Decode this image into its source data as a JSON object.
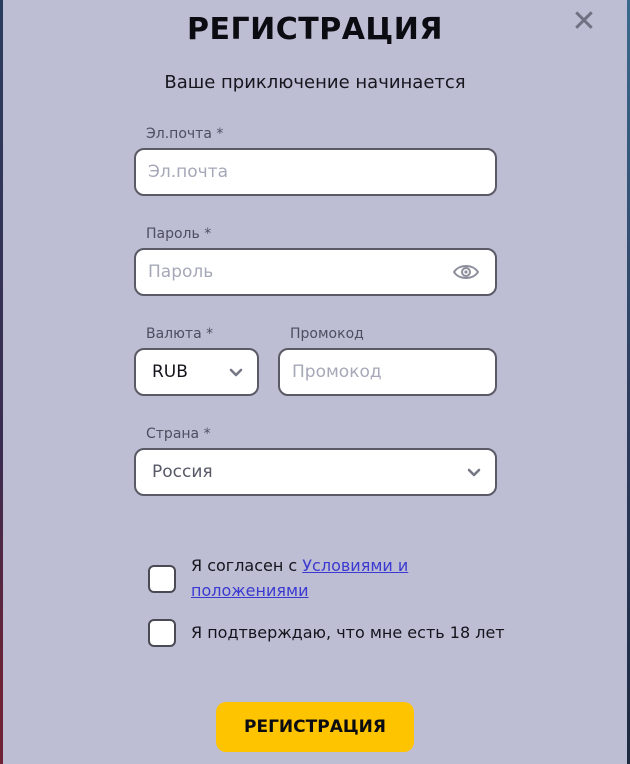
{
  "modal": {
    "close_glyph": "✕",
    "title": "РЕГИСТРАЦИЯ",
    "subtitle": "Ваше приключение начинается"
  },
  "form": {
    "email": {
      "label": "Эл.почта *",
      "placeholder": "Эл.почта",
      "value": ""
    },
    "password": {
      "label": "Пароль *",
      "placeholder": "Пароль",
      "value": "",
      "icon": "eye-icon"
    },
    "currency": {
      "label": "Валюта *",
      "selected": "RUB"
    },
    "promo": {
      "label": "Промокод",
      "placeholder": "Промокод",
      "value": ""
    },
    "country": {
      "label": "Страна *",
      "selected": "Россия"
    }
  },
  "agreements": {
    "terms_prefix": "Я согласен с ",
    "terms_link": "Условиями и положениями",
    "terms_checked": false,
    "age_text": "Я подтверждаю, что мне есть 18 лет",
    "age_checked": false
  },
  "submit_label": "РЕГИСТРАЦИЯ",
  "colors": {
    "modal_bg": "#bdbdd4",
    "accent": "#ffc400",
    "link": "#3b3ad0",
    "field_border": "#5a5a66"
  }
}
